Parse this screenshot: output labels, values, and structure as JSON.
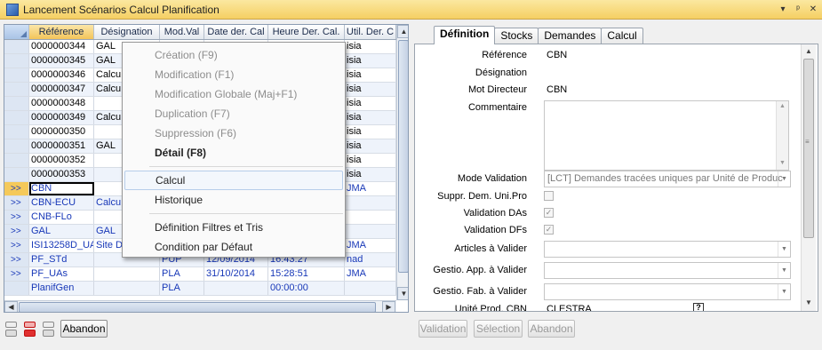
{
  "window": {
    "title": "Lancement Scénarios Calcul Planification",
    "controls": [
      "▾",
      "ᵖ",
      "✕"
    ]
  },
  "grid": {
    "columns": [
      "",
      "Référence",
      "Désignation",
      "Mod.Val",
      "Date der. Cal",
      "Heure Der. Cal.",
      "Util. Der. C"
    ],
    "rows": [
      {
        "ind": "",
        "ref": "0000000344",
        "des": "GAL",
        "mod": "",
        "date": "",
        "heure": "",
        "util": "isia"
      },
      {
        "ind": "",
        "ref": "0000000345",
        "des": "GAL",
        "mod": "",
        "date": "",
        "heure": "",
        "util": "isia"
      },
      {
        "ind": "",
        "ref": "0000000346",
        "des": "Calcu",
        "mod": "",
        "date": "",
        "heure": "",
        "util": "isia"
      },
      {
        "ind": "",
        "ref": "0000000347",
        "des": "Calcu",
        "mod": "",
        "date": "",
        "heure": "",
        "util": "isia"
      },
      {
        "ind": "",
        "ref": "0000000348",
        "des": "",
        "mod": "",
        "date": "",
        "heure": "",
        "util": "isia"
      },
      {
        "ind": "",
        "ref": "0000000349",
        "des": "Calcu",
        "mod": "",
        "date": "",
        "heure": "",
        "util": "isia"
      },
      {
        "ind": "",
        "ref": "0000000350",
        "des": "",
        "mod": "",
        "date": "",
        "heure": "",
        "util": "isia"
      },
      {
        "ind": "",
        "ref": "0000000351",
        "des": "GAL",
        "mod": "",
        "date": "",
        "heure": "",
        "util": "isia"
      },
      {
        "ind": "",
        "ref": "0000000352",
        "des": "",
        "mod": "",
        "date": "",
        "heure": "",
        "util": "isia"
      },
      {
        "ind": "",
        "ref": "0000000353",
        "des": "",
        "mod": "",
        "date": "",
        "heure": "",
        "util": "isia"
      },
      {
        "ind": ">>",
        "ref": "CBN",
        "des": "",
        "mod": "",
        "date": "",
        "heure": "",
        "util": "JMA"
      },
      {
        "ind": ">>",
        "ref": "CBN-ECU",
        "des": "Calcu",
        "mod": "",
        "date": "",
        "heure": "",
        "util": ""
      },
      {
        "ind": ">>",
        "ref": "CNB-FLo",
        "des": "",
        "mod": "",
        "date": "",
        "heure": "",
        "util": ""
      },
      {
        "ind": ">>",
        "ref": "GAL",
        "des": "GAL",
        "mod": "",
        "date": "",
        "heure": "",
        "util": ""
      },
      {
        "ind": ">>",
        "ref": "ISI13258D_UA",
        "des": "Site D",
        "mod": "",
        "date": "",
        "heure": "",
        "util": "JMA"
      },
      {
        "ind": ">>",
        "ref": "PF_STd",
        "des": "",
        "mod": "PUP",
        "date": "12/09/2014",
        "heure": "16:43:27",
        "util": "nad"
      },
      {
        "ind": ">>",
        "ref": "PF_UAs",
        "des": "",
        "mod": "PLA",
        "date": "31/10/2014",
        "heure": "15:28:51",
        "util": "JMA"
      },
      {
        "ind": "",
        "ref": "PlanifGen",
        "des": "",
        "mod": "PLA",
        "date": "",
        "heure": "00:00:00",
        "util": ""
      }
    ]
  },
  "context_menu": {
    "items": [
      {
        "label": "Création (F9)",
        "state": "disabled"
      },
      {
        "label": "Modification (F1)",
        "state": "disabled"
      },
      {
        "label": "Modification Globale (Maj+F1)",
        "state": "disabled"
      },
      {
        "label": "Duplication (F7)",
        "state": "disabled"
      },
      {
        "label": "Suppression (F6)",
        "state": "disabled"
      },
      {
        "label": "Détail (F8)",
        "state": "bold"
      },
      {
        "label": "Calcul",
        "state": "highlighted"
      },
      {
        "label": "Historique",
        "state": "normal"
      },
      {
        "label": "Définition Filtres et Tris",
        "state": "normal"
      },
      {
        "label": "Condition par Défaut",
        "state": "normal"
      }
    ]
  },
  "left_footer": {
    "abandon_label": "Abandon"
  },
  "detail": {
    "tabs": [
      "Définition",
      "Stocks",
      "Demandes",
      "Calcul"
    ],
    "active_tab": "Définition",
    "labels": {
      "reference": "Référence",
      "designation": "Désignation",
      "mot_directeur": "Mot Directeur",
      "commentaire": "Commentaire",
      "mode_validation": "Mode Validation",
      "suppr": "Suppr. Dem. Uni.Pro",
      "val_das": "Validation DAs",
      "val_dfs": "Validation DFs",
      "articles": "Articles à Valider",
      "gestio_app": "Gestio. App. à Valider",
      "gestio_fab": "Gestio. Fab. à Valider",
      "unite_prod": "Unité Prod. CBN"
    },
    "values": {
      "reference": "CBN",
      "designation": "",
      "mot_directeur": "CBN",
      "mode_validation": "[LCT] Demandes tracées uniques par Unité de Produc",
      "unite_prod": "CLESTRA",
      "help_button": "?"
    },
    "checks": {
      "suppr": false,
      "val_das": true,
      "val_dfs": true
    },
    "buttons": {
      "validation": "Validation",
      "selection": "Sélection",
      "abandon": "Abandon"
    }
  },
  "colors": {
    "title_bar": "#f5cf63",
    "row_alt": "#eef3fb",
    "link_blue": "#1838b8"
  }
}
